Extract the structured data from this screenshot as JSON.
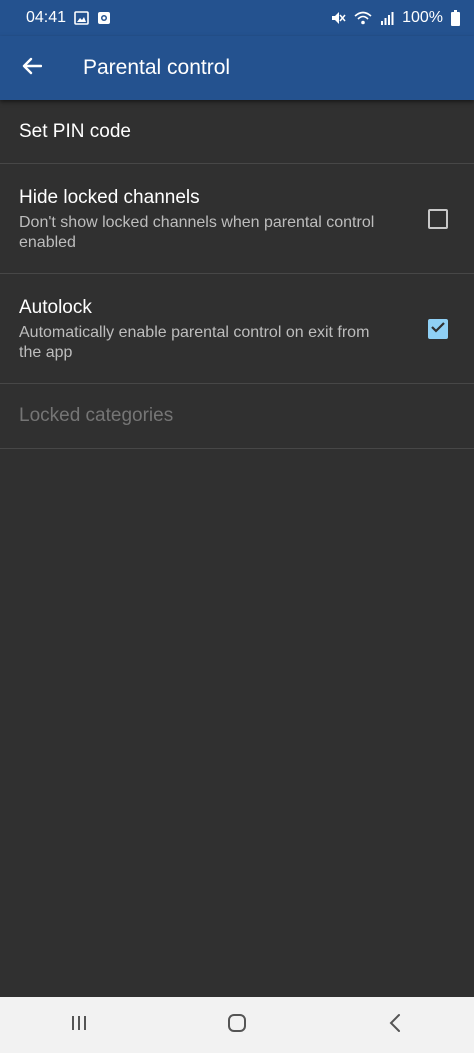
{
  "status": {
    "time": "04:41",
    "battery": "100%",
    "icons": [
      "image-icon",
      "screen-record-icon",
      "mute-icon",
      "wifi-icon",
      "signal-icon",
      "battery-icon"
    ]
  },
  "appbar": {
    "title": "Parental control",
    "back_icon": "arrow-back-icon",
    "color": "#24528f"
  },
  "settings": {
    "set_pin": {
      "title": "Set PIN code"
    },
    "hide_locked": {
      "title": "Hide locked channels",
      "subtitle": "Don't show locked channels when parental control enabled",
      "checked": false
    },
    "autolock": {
      "title": "Autolock",
      "subtitle": "Automatically enable parental control on exit from the app",
      "checked": true
    },
    "locked_categories": {
      "title": "Locked categories",
      "enabled": false
    }
  },
  "navbar": {
    "icons": [
      "recent-apps-icon",
      "home-icon",
      "back-icon"
    ],
    "background": "#f2f2f2"
  },
  "colors": {
    "background": "#303030",
    "accent": "#8fd0f5"
  }
}
